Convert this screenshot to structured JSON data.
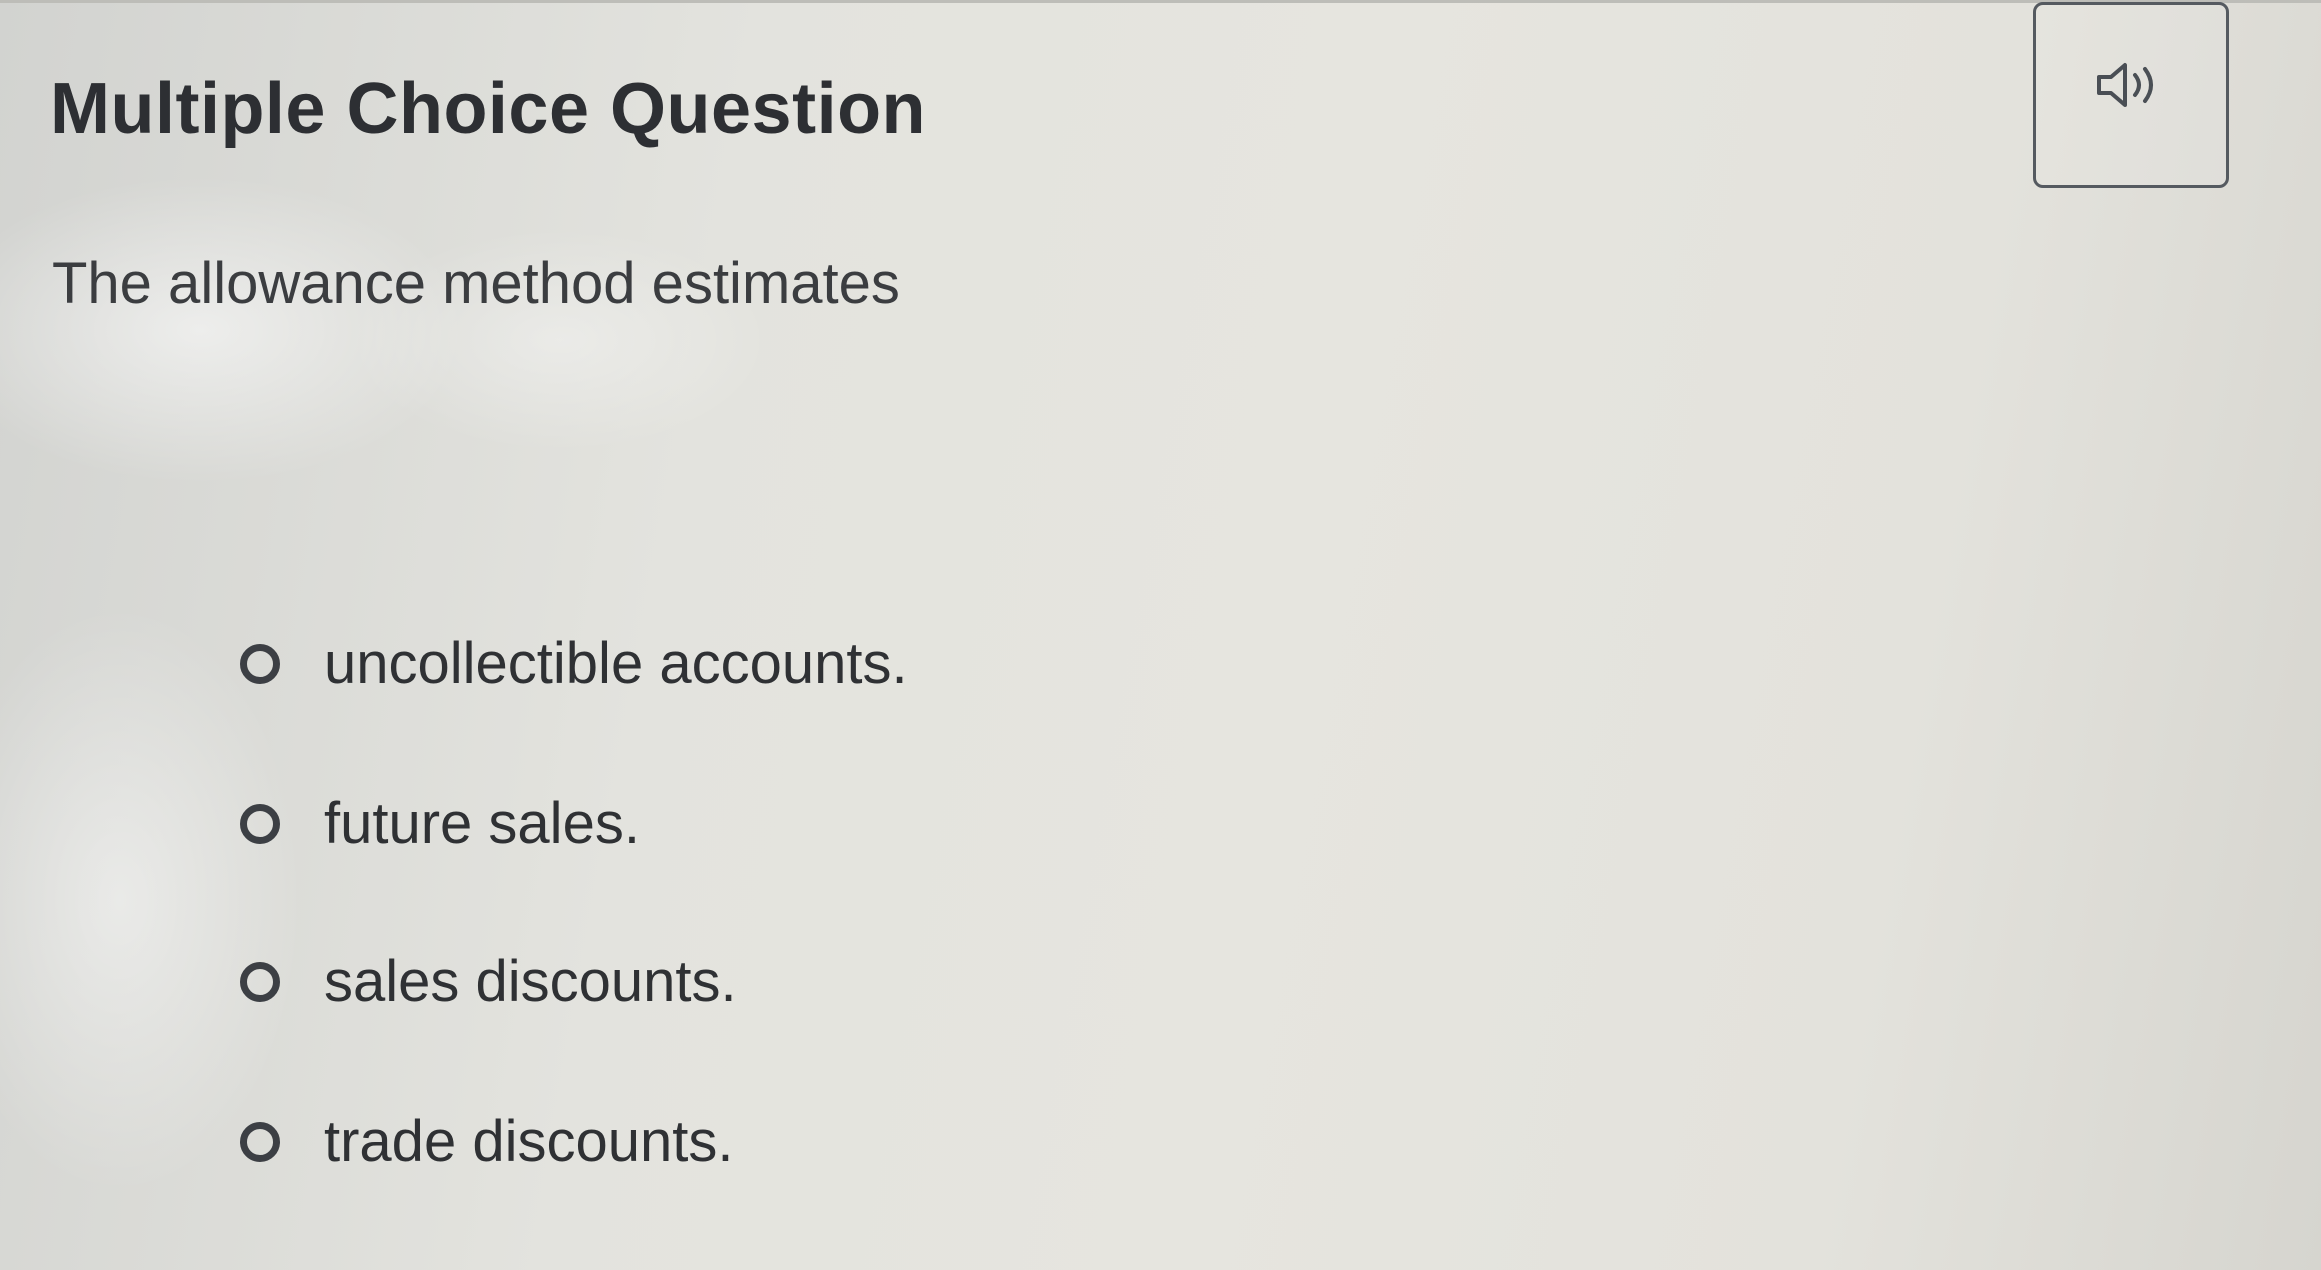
{
  "question": {
    "title": "Multiple Choice Question",
    "prompt": "The allowance method estimates",
    "options": [
      {
        "label": "uncollectible accounts.",
        "selected": false
      },
      {
        "label": "future sales.",
        "selected": false
      },
      {
        "label": "sales discounts.",
        "selected": false
      },
      {
        "label": "trade discounts.",
        "selected": false
      }
    ]
  },
  "toolbar": {
    "audio_icon": "speaker-icon"
  },
  "colors": {
    "text": "#2f3134",
    "title": "#2d2f33",
    "border": "#555a60",
    "background": "#e4e3de"
  }
}
